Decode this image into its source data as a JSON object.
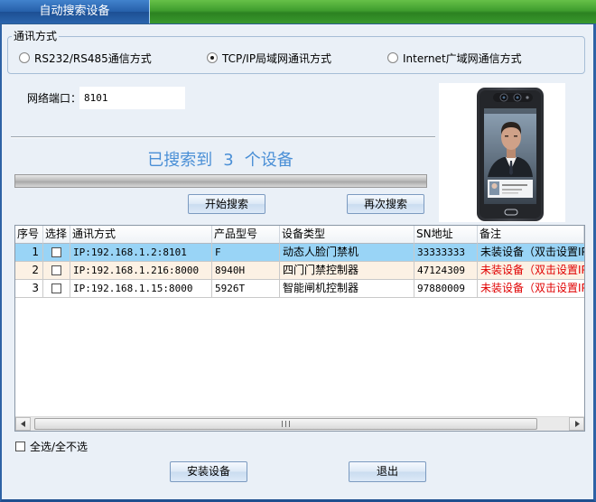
{
  "window": {
    "title": "自动搜索设备"
  },
  "comm_mode": {
    "group_label": "通讯方式",
    "options": [
      {
        "label": "RS232/RS485通信方式",
        "selected": false
      },
      {
        "label": "TCP/IP局域网通讯方式",
        "selected": true
      },
      {
        "label": "Internet广域网通信方式",
        "selected": false
      }
    ]
  },
  "network": {
    "port_label": "网络端口：",
    "port_value": "8101"
  },
  "search_status": {
    "prefix": "已搜索到",
    "count": "3",
    "suffix": "个设备"
  },
  "buttons": {
    "start_search": "开始搜索",
    "search_again": "再次搜索",
    "install": "安装设备",
    "exit": "退出"
  },
  "table": {
    "columns": [
      "序号",
      "选择",
      "通讯方式",
      "产品型号",
      "设备类型",
      "SN地址",
      "备注"
    ],
    "selected_row": 0,
    "rows": [
      {
        "index": "1",
        "checked": false,
        "comm": "IP:192.168.1.2:8101",
        "model": "F",
        "type": "动态人脸门禁机",
        "sn": "33333333",
        "remark": "未装设备（双击设置IP"
      },
      {
        "index": "2",
        "checked": false,
        "comm": "IP:192.168.1.216:8000",
        "model": "8940H",
        "type": "四门门禁控制器",
        "sn": "47124309",
        "remark": "未装设备（双击设置IP"
      },
      {
        "index": "3",
        "checked": false,
        "comm": "IP:192.168.1.15:8000",
        "model": "5926T",
        "type": "智能闸机控制器",
        "sn": "97880009",
        "remark": "未装设备（双击设置IP"
      }
    ]
  },
  "select_all": {
    "label": "全选/全不选",
    "checked": false
  },
  "colors": {
    "status_text": "#4a8fd6",
    "remark_text": "#e00000",
    "selected_row_bg": "#99d4f6",
    "alt_row_bg": "#fcf1e4"
  }
}
